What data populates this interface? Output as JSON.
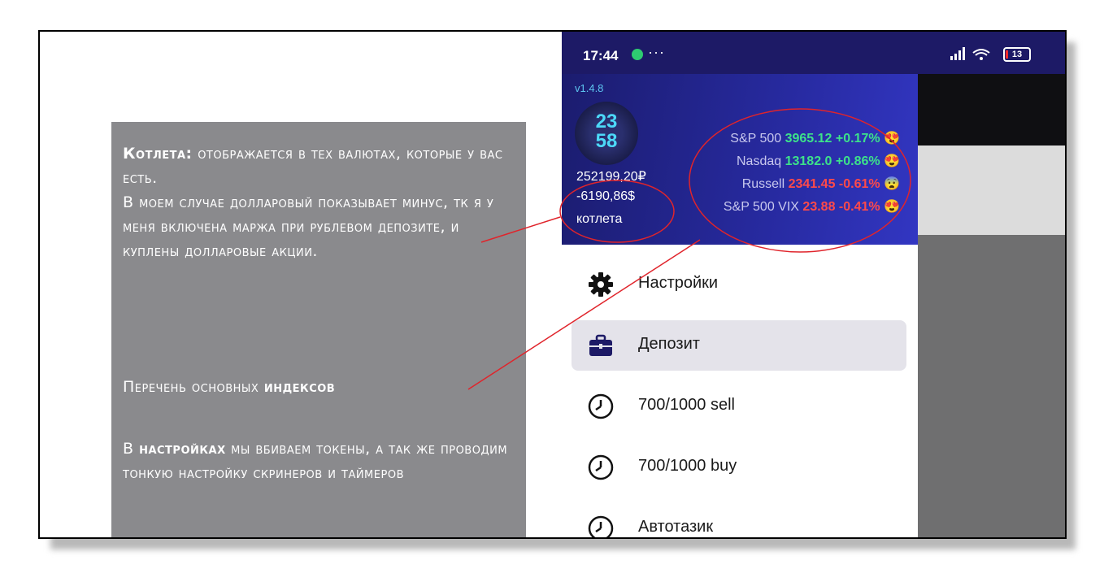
{
  "note": {
    "p1_bold": "Котлета:",
    "p1_rest": " отображается в тех валютах, которые у вас есть.",
    "p2": "В моем случае долларовый показывает минус, тк я у меня включена маржа при рублевом депозите, и куплены долларовые акции.",
    "p3_plain": "Перечень основных ",
    "p3_bold": "индексов",
    "p4_start": "В ",
    "p4_bold": "настройках",
    "p4_rest": " мы вбиваем токены, а так же проводим тонкую настройку скринеров и таймеров"
  },
  "status_bar": {
    "time": "17:44",
    "dots": "···",
    "signal": "📶",
    "battery": "13"
  },
  "drawer": {
    "version": "v1.4.8",
    "clock_hours": "23",
    "clock_minutes": "58",
    "balance_rub": "252199,20₽",
    "balance_usd": "-6190,86$",
    "balance_label": "котлета",
    "indices": [
      {
        "name": "S&P 500",
        "value": "3965.12",
        "change": "+0.17%",
        "emoji": "😍"
      },
      {
        "name": "Nasdaq",
        "value": "13182.0",
        "change": "+0.86%",
        "emoji": "😍"
      },
      {
        "name": "Russell",
        "value": "2341.45",
        "change": "-0.61%",
        "emoji": "😨"
      },
      {
        "name": "S&P 500 VIX",
        "value": "23.88",
        "change": "-0.41%",
        "emoji": "😍"
      }
    ]
  },
  "menu": {
    "items": [
      {
        "label": "Настройки",
        "icon": "gear-icon"
      },
      {
        "label": "Депозит",
        "icon": "briefcase-icon"
      },
      {
        "label": "700/1000 sell",
        "icon": "clock-icon"
      },
      {
        "label": "700/1000 buy",
        "icon": "clock-icon"
      },
      {
        "label": "Автотазик",
        "icon": "clock-icon"
      }
    ]
  },
  "colors": {
    "accent": "#1d1a66",
    "positive": "#3de28a",
    "negative": "#ff4a4a",
    "annotation": "#e0242b"
  }
}
